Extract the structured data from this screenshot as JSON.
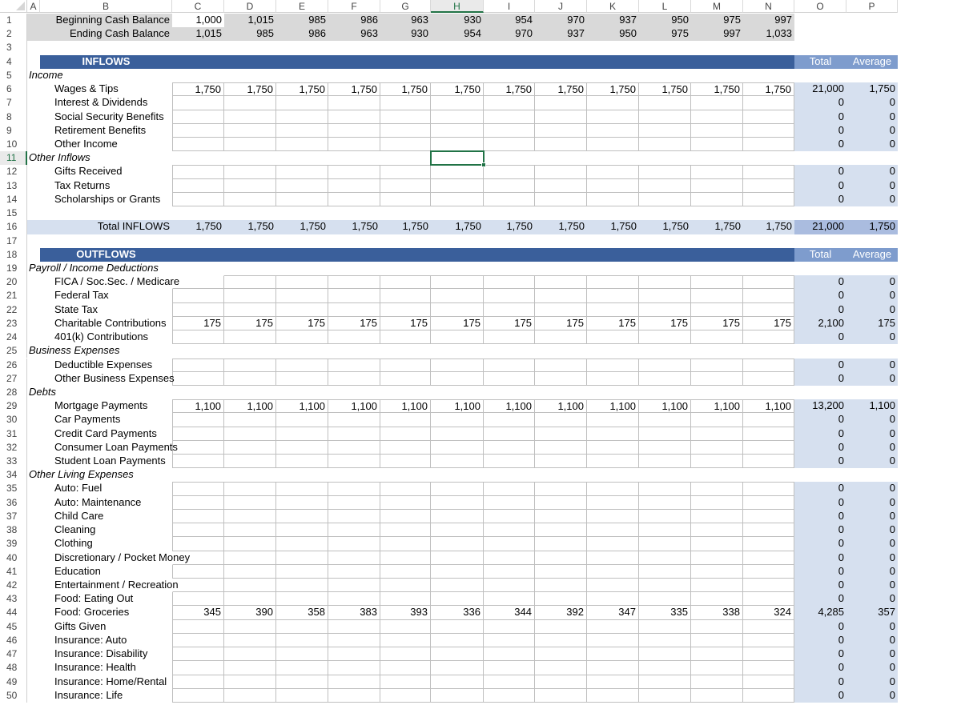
{
  "columns": [
    "A",
    "B",
    "C",
    "D",
    "E",
    "F",
    "G",
    "H",
    "I",
    "J",
    "K",
    "L",
    "M",
    "N",
    "O",
    "P"
  ],
  "selected_column": "H",
  "selected_row": 11,
  "balance": {
    "beginning_label": "Beginning Cash Balance",
    "ending_label": "Ending Cash Balance",
    "beginning": [
      "1,000",
      "1,015",
      "985",
      "986",
      "963",
      "930",
      "954",
      "970",
      "937",
      "950",
      "975",
      "997"
    ],
    "ending": [
      "1,015",
      "985",
      "986",
      "963",
      "930",
      "954",
      "970",
      "937",
      "950",
      "975",
      "997",
      "1,033"
    ]
  },
  "inflows": {
    "title": "INFLOWS",
    "total_header": "Total",
    "average_header": "Average",
    "sections": [
      {
        "category": "Income",
        "row": 5,
        "items": [
          {
            "row": 6,
            "label": "Wages & Tips",
            "values": [
              "1,750",
              "1,750",
              "1,750",
              "1,750",
              "1,750",
              "1,750",
              "1,750",
              "1,750",
              "1,750",
              "1,750",
              "1,750",
              "1,750"
            ],
            "total": "21,000",
            "average": "1,750"
          },
          {
            "row": 7,
            "label": "Interest & Dividends",
            "values": [],
            "total": "0",
            "average": "0"
          },
          {
            "row": 8,
            "label": "Social Security Benefits",
            "values": [],
            "total": "0",
            "average": "0"
          },
          {
            "row": 9,
            "label": "Retirement Benefits",
            "values": [],
            "total": "0",
            "average": "0"
          },
          {
            "row": 10,
            "label": "Other Income",
            "values": [],
            "total": "0",
            "average": "0"
          }
        ]
      },
      {
        "category": "Other Inflows",
        "row": 11,
        "items": [
          {
            "row": 12,
            "label": "Gifts Received",
            "values": [],
            "total": "0",
            "average": "0"
          },
          {
            "row": 13,
            "label": "Tax Returns",
            "values": [],
            "total": "0",
            "average": "0"
          },
          {
            "row": 14,
            "label": "Scholarships or Grants",
            "values": [],
            "total": "0",
            "average": "0"
          }
        ]
      }
    ],
    "total_row": {
      "row": 16,
      "label": "Total INFLOWS",
      "values": [
        "1,750",
        "1,750",
        "1,750",
        "1,750",
        "1,750",
        "1,750",
        "1,750",
        "1,750",
        "1,750",
        "1,750",
        "1,750",
        "1,750"
      ],
      "total": "21,000",
      "average": "1,750"
    }
  },
  "outflows": {
    "title": "OUTFLOWS",
    "total_header": "Total",
    "average_header": "Average",
    "sections": [
      {
        "category": "Payroll / Income Deductions",
        "row": 19,
        "items": [
          {
            "row": 20,
            "label": "FICA / Soc.Sec. / Medicare",
            "values": [],
            "total": "0",
            "average": "0"
          },
          {
            "row": 21,
            "label": "Federal Tax",
            "values": [],
            "total": "0",
            "average": "0"
          },
          {
            "row": 22,
            "label": "State Tax",
            "values": [],
            "total": "0",
            "average": "0"
          },
          {
            "row": 23,
            "label": "Charitable Contributions",
            "values": [
              "175",
              "175",
              "175",
              "175",
              "175",
              "175",
              "175",
              "175",
              "175",
              "175",
              "175",
              "175"
            ],
            "total": "2,100",
            "average": "175"
          },
          {
            "row": 24,
            "label": "401(k) Contributions",
            "values": [],
            "total": "0",
            "average": "0"
          }
        ]
      },
      {
        "category": "Business Expenses",
        "row": 25,
        "items": [
          {
            "row": 26,
            "label": "Deductible Expenses",
            "values": [],
            "total": "0",
            "average": "0"
          },
          {
            "row": 27,
            "label": "Other Business Expenses",
            "values": [],
            "total": "0",
            "average": "0"
          }
        ]
      },
      {
        "category": "Debts",
        "row": 28,
        "items": [
          {
            "row": 29,
            "label": "Mortgage Payments",
            "values": [
              "1,100",
              "1,100",
              "1,100",
              "1,100",
              "1,100",
              "1,100",
              "1,100",
              "1,100",
              "1,100",
              "1,100",
              "1,100",
              "1,100"
            ],
            "total": "13,200",
            "average": "1,100"
          },
          {
            "row": 30,
            "label": "Car Payments",
            "values": [],
            "total": "0",
            "average": "0"
          },
          {
            "row": 31,
            "label": "Credit Card Payments",
            "values": [],
            "total": "0",
            "average": "0"
          },
          {
            "row": 32,
            "label": "Consumer Loan Payments",
            "values": [],
            "total": "0",
            "average": "0"
          },
          {
            "row": 33,
            "label": "Student Loan Payments",
            "values": [],
            "total": "0",
            "average": "0"
          }
        ]
      },
      {
        "category": "Other Living Expenses",
        "row": 34,
        "items": [
          {
            "row": 35,
            "label": "Auto: Fuel",
            "values": [],
            "total": "0",
            "average": "0"
          },
          {
            "row": 36,
            "label": "Auto: Maintenance",
            "values": [],
            "total": "0",
            "average": "0"
          },
          {
            "row": 37,
            "label": "Child Care",
            "values": [],
            "total": "0",
            "average": "0"
          },
          {
            "row": 38,
            "label": "Cleaning",
            "values": [],
            "total": "0",
            "average": "0"
          },
          {
            "row": 39,
            "label": "Clothing",
            "values": [],
            "total": "0",
            "average": "0"
          },
          {
            "row": 40,
            "label": "Discretionary / Pocket Money",
            "values": [],
            "total": "0",
            "average": "0"
          },
          {
            "row": 41,
            "label": "Education",
            "values": [],
            "total": "0",
            "average": "0"
          },
          {
            "row": 42,
            "label": "Entertainment / Recreation",
            "values": [],
            "total": "0",
            "average": "0"
          },
          {
            "row": 43,
            "label": "Food: Eating Out",
            "values": [],
            "total": "0",
            "average": "0"
          },
          {
            "row": 44,
            "label": "Food: Groceries",
            "values": [
              "345",
              "390",
              "358",
              "383",
              "393",
              "336",
              "344",
              "392",
              "347",
              "335",
              "338",
              "324"
            ],
            "total": "4,285",
            "average": "357"
          },
          {
            "row": 45,
            "label": "Gifts Given",
            "values": [],
            "total": "0",
            "average": "0"
          },
          {
            "row": 46,
            "label": "Insurance: Auto",
            "values": [],
            "total": "0",
            "average": "0"
          },
          {
            "row": 47,
            "label": "Insurance: Disability",
            "values": [],
            "total": "0",
            "average": "0"
          },
          {
            "row": 48,
            "label": "Insurance: Health",
            "values": [],
            "total": "0",
            "average": "0"
          },
          {
            "row": 49,
            "label": "Insurance: Home/Rental",
            "values": [],
            "total": "0",
            "average": "0"
          },
          {
            "row": 50,
            "label": "Insurance: Life",
            "values": [],
            "total": "0",
            "average": "0"
          }
        ]
      }
    ]
  }
}
